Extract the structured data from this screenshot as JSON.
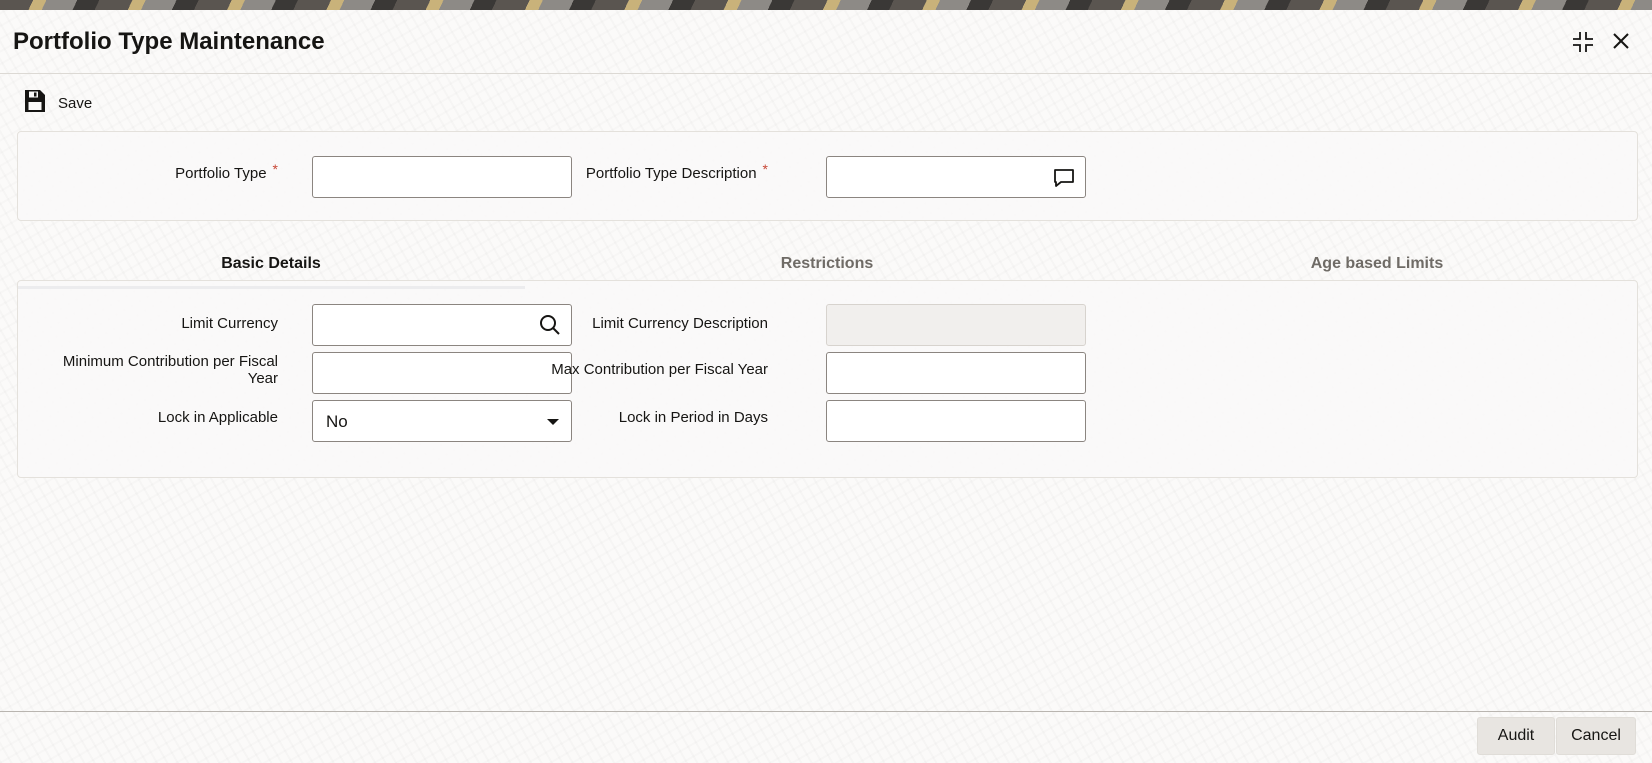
{
  "window": {
    "title": "Portfolio Type Maintenance",
    "minimize_icon": "compress-icon",
    "close_icon": "close-icon"
  },
  "toolbar": {
    "save_label": "Save",
    "save_icon": "floppy-disk-icon"
  },
  "header": {
    "portfolio_type": {
      "label": "Portfolio Type",
      "required_mark": "*",
      "value": ""
    },
    "portfolio_type_description": {
      "label": "Portfolio Type Description",
      "required_mark": "*",
      "value": "",
      "icon": "comment-icon"
    }
  },
  "tabs": [
    {
      "label": "Basic Details",
      "active": true
    },
    {
      "label": "Restrictions",
      "active": false
    },
    {
      "label": "Age based Limits",
      "active": false
    }
  ],
  "basic_details": {
    "limit_currency": {
      "label": "Limit Currency",
      "value": "",
      "icon": "search-icon"
    },
    "limit_currency_description": {
      "label": "Limit Currency Description",
      "value": ""
    },
    "min_contribution": {
      "label_line1": "Minimum Contribution per Fiscal",
      "label_line2": "Year",
      "value": ""
    },
    "max_contribution": {
      "label": "Max Contribution per Fiscal Year",
      "value": ""
    },
    "lock_in_applicable": {
      "label": "Lock in Applicable",
      "selected": "No"
    },
    "lock_in_period": {
      "label": "Lock in Period in Days",
      "value": ""
    }
  },
  "footer": {
    "audit_label": "Audit",
    "cancel_label": "Cancel"
  },
  "colors": {
    "required": "#c74634",
    "active_tab_underline": "#4f5b6e",
    "text": "#161513"
  }
}
